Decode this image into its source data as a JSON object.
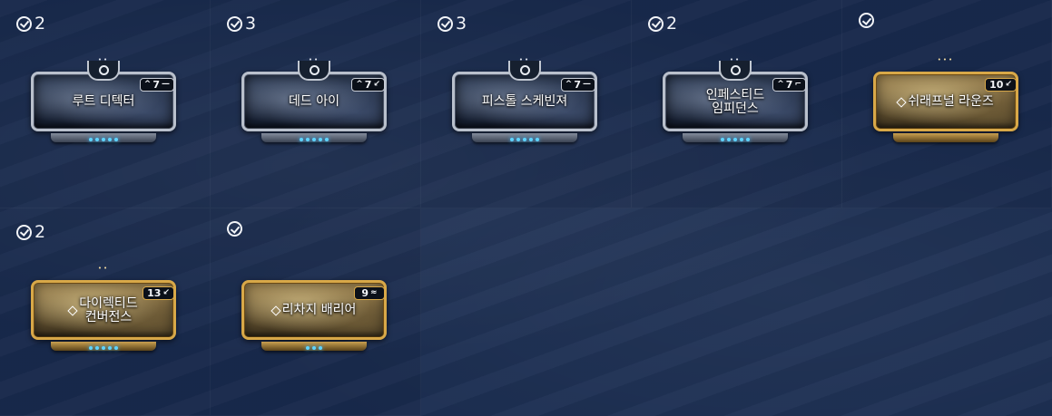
{
  "colors": {
    "background": "#1b2d51",
    "rank_light": "#5fd4ff",
    "gold_frame": "#d8a848",
    "silver_frame": "#b9c0cc"
  },
  "mods": [
    {
      "id": "loot-detector",
      "owned_count": "2",
      "name": "루트 디텍터",
      "drain": "7",
      "drain_polarity_icon": "dash-polarity-icon",
      "rank": "5",
      "frame": "silver",
      "aura": false,
      "two_line": false,
      "rank_dots": "••"
    },
    {
      "id": "dead-eye",
      "owned_count": "3",
      "name": "데드 아이",
      "drain": "7",
      "drain_polarity_icon": "madurai-polarity-icon",
      "rank": "5",
      "frame": "silver",
      "aura": false,
      "two_line": false,
      "rank_dots": "••"
    },
    {
      "id": "pistol-scavenger",
      "owned_count": "3",
      "name": "피스톨 스케빈져",
      "drain": "7",
      "drain_polarity_icon": "dash-polarity-icon",
      "rank": "5",
      "frame": "silver",
      "aura": false,
      "two_line": false,
      "rank_dots": "••"
    },
    {
      "id": "infested-impedance",
      "owned_count": "2",
      "name": "인페스티드\n임피던스",
      "drain": "7",
      "drain_polarity_icon": "naramon-polarity-icon",
      "rank": "5",
      "frame": "silver",
      "aura": false,
      "two_line": true,
      "rank_dots": "••"
    },
    {
      "id": "shrapnel-rounds",
      "owned_count": "",
      "name": "쉬래프널 라운즈",
      "drain": "10",
      "drain_polarity_icon": "madurai-polarity-icon",
      "rank": "0",
      "frame": "gold",
      "aura": true,
      "two_line": false,
      "rank_dots": "•••"
    },
    {
      "id": "directed-convergence",
      "owned_count": "2",
      "name": "다이렉티드\n컨버전스",
      "drain": "13",
      "drain_polarity_icon": "madurai-polarity-icon",
      "rank": "5",
      "frame": "gold",
      "aura": true,
      "two_line": true,
      "rank_dots": "••"
    },
    {
      "id": "recharge-barrier",
      "owned_count": "",
      "name": "리차지 배리어",
      "drain": "9",
      "drain_polarity_icon": "vazarin-polarity-icon",
      "rank": "3",
      "frame": "gold",
      "aura": true,
      "two_line": false,
      "rank_dots": ""
    }
  ]
}
